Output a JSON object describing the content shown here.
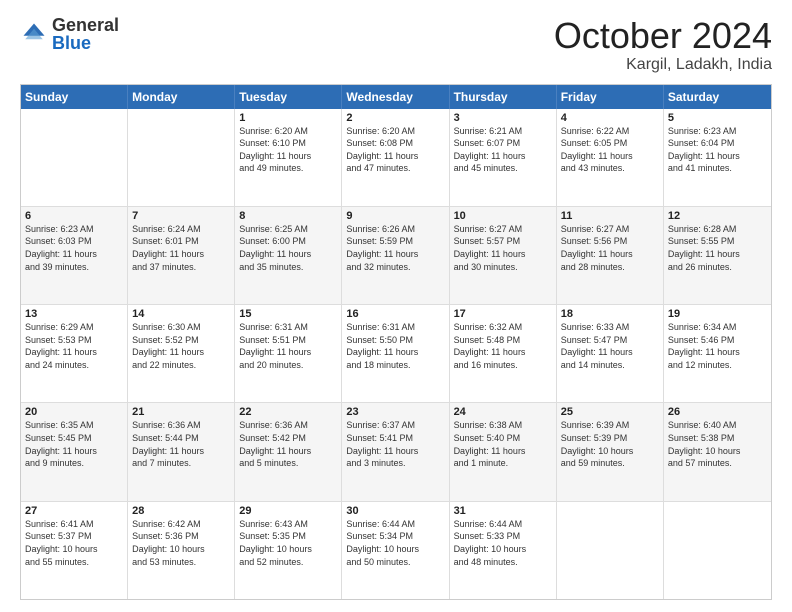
{
  "logo": {
    "general": "General",
    "blue": "Blue"
  },
  "title": {
    "month_year": "October 2024",
    "location": "Kargil, Ladakh, India"
  },
  "header_days": [
    "Sunday",
    "Monday",
    "Tuesday",
    "Wednesday",
    "Thursday",
    "Friday",
    "Saturday"
  ],
  "rows": [
    [
      {
        "day": "",
        "lines": []
      },
      {
        "day": "",
        "lines": []
      },
      {
        "day": "1",
        "lines": [
          "Sunrise: 6:20 AM",
          "Sunset: 6:10 PM",
          "Daylight: 11 hours",
          "and 49 minutes."
        ]
      },
      {
        "day": "2",
        "lines": [
          "Sunrise: 6:20 AM",
          "Sunset: 6:08 PM",
          "Daylight: 11 hours",
          "and 47 minutes."
        ]
      },
      {
        "day": "3",
        "lines": [
          "Sunrise: 6:21 AM",
          "Sunset: 6:07 PM",
          "Daylight: 11 hours",
          "and 45 minutes."
        ]
      },
      {
        "day": "4",
        "lines": [
          "Sunrise: 6:22 AM",
          "Sunset: 6:05 PM",
          "Daylight: 11 hours",
          "and 43 minutes."
        ]
      },
      {
        "day": "5",
        "lines": [
          "Sunrise: 6:23 AM",
          "Sunset: 6:04 PM",
          "Daylight: 11 hours",
          "and 41 minutes."
        ]
      }
    ],
    [
      {
        "day": "6",
        "lines": [
          "Sunrise: 6:23 AM",
          "Sunset: 6:03 PM",
          "Daylight: 11 hours",
          "and 39 minutes."
        ]
      },
      {
        "day": "7",
        "lines": [
          "Sunrise: 6:24 AM",
          "Sunset: 6:01 PM",
          "Daylight: 11 hours",
          "and 37 minutes."
        ]
      },
      {
        "day": "8",
        "lines": [
          "Sunrise: 6:25 AM",
          "Sunset: 6:00 PM",
          "Daylight: 11 hours",
          "and 35 minutes."
        ]
      },
      {
        "day": "9",
        "lines": [
          "Sunrise: 6:26 AM",
          "Sunset: 5:59 PM",
          "Daylight: 11 hours",
          "and 32 minutes."
        ]
      },
      {
        "day": "10",
        "lines": [
          "Sunrise: 6:27 AM",
          "Sunset: 5:57 PM",
          "Daylight: 11 hours",
          "and 30 minutes."
        ]
      },
      {
        "day": "11",
        "lines": [
          "Sunrise: 6:27 AM",
          "Sunset: 5:56 PM",
          "Daylight: 11 hours",
          "and 28 minutes."
        ]
      },
      {
        "day": "12",
        "lines": [
          "Sunrise: 6:28 AM",
          "Sunset: 5:55 PM",
          "Daylight: 11 hours",
          "and 26 minutes."
        ]
      }
    ],
    [
      {
        "day": "13",
        "lines": [
          "Sunrise: 6:29 AM",
          "Sunset: 5:53 PM",
          "Daylight: 11 hours",
          "and 24 minutes."
        ]
      },
      {
        "day": "14",
        "lines": [
          "Sunrise: 6:30 AM",
          "Sunset: 5:52 PM",
          "Daylight: 11 hours",
          "and 22 minutes."
        ]
      },
      {
        "day": "15",
        "lines": [
          "Sunrise: 6:31 AM",
          "Sunset: 5:51 PM",
          "Daylight: 11 hours",
          "and 20 minutes."
        ]
      },
      {
        "day": "16",
        "lines": [
          "Sunrise: 6:31 AM",
          "Sunset: 5:50 PM",
          "Daylight: 11 hours",
          "and 18 minutes."
        ]
      },
      {
        "day": "17",
        "lines": [
          "Sunrise: 6:32 AM",
          "Sunset: 5:48 PM",
          "Daylight: 11 hours",
          "and 16 minutes."
        ]
      },
      {
        "day": "18",
        "lines": [
          "Sunrise: 6:33 AM",
          "Sunset: 5:47 PM",
          "Daylight: 11 hours",
          "and 14 minutes."
        ]
      },
      {
        "day": "19",
        "lines": [
          "Sunrise: 6:34 AM",
          "Sunset: 5:46 PM",
          "Daylight: 11 hours",
          "and 12 minutes."
        ]
      }
    ],
    [
      {
        "day": "20",
        "lines": [
          "Sunrise: 6:35 AM",
          "Sunset: 5:45 PM",
          "Daylight: 11 hours",
          "and 9 minutes."
        ]
      },
      {
        "day": "21",
        "lines": [
          "Sunrise: 6:36 AM",
          "Sunset: 5:44 PM",
          "Daylight: 11 hours",
          "and 7 minutes."
        ]
      },
      {
        "day": "22",
        "lines": [
          "Sunrise: 6:36 AM",
          "Sunset: 5:42 PM",
          "Daylight: 11 hours",
          "and 5 minutes."
        ]
      },
      {
        "day": "23",
        "lines": [
          "Sunrise: 6:37 AM",
          "Sunset: 5:41 PM",
          "Daylight: 11 hours",
          "and 3 minutes."
        ]
      },
      {
        "day": "24",
        "lines": [
          "Sunrise: 6:38 AM",
          "Sunset: 5:40 PM",
          "Daylight: 11 hours",
          "and 1 minute."
        ]
      },
      {
        "day": "25",
        "lines": [
          "Sunrise: 6:39 AM",
          "Sunset: 5:39 PM",
          "Daylight: 10 hours",
          "and 59 minutes."
        ]
      },
      {
        "day": "26",
        "lines": [
          "Sunrise: 6:40 AM",
          "Sunset: 5:38 PM",
          "Daylight: 10 hours",
          "and 57 minutes."
        ]
      }
    ],
    [
      {
        "day": "27",
        "lines": [
          "Sunrise: 6:41 AM",
          "Sunset: 5:37 PM",
          "Daylight: 10 hours",
          "and 55 minutes."
        ]
      },
      {
        "day": "28",
        "lines": [
          "Sunrise: 6:42 AM",
          "Sunset: 5:36 PM",
          "Daylight: 10 hours",
          "and 53 minutes."
        ]
      },
      {
        "day": "29",
        "lines": [
          "Sunrise: 6:43 AM",
          "Sunset: 5:35 PM",
          "Daylight: 10 hours",
          "and 52 minutes."
        ]
      },
      {
        "day": "30",
        "lines": [
          "Sunrise: 6:44 AM",
          "Sunset: 5:34 PM",
          "Daylight: 10 hours",
          "and 50 minutes."
        ]
      },
      {
        "day": "31",
        "lines": [
          "Sunrise: 6:44 AM",
          "Sunset: 5:33 PM",
          "Daylight: 10 hours",
          "and 48 minutes."
        ]
      },
      {
        "day": "",
        "lines": []
      },
      {
        "day": "",
        "lines": []
      }
    ]
  ]
}
